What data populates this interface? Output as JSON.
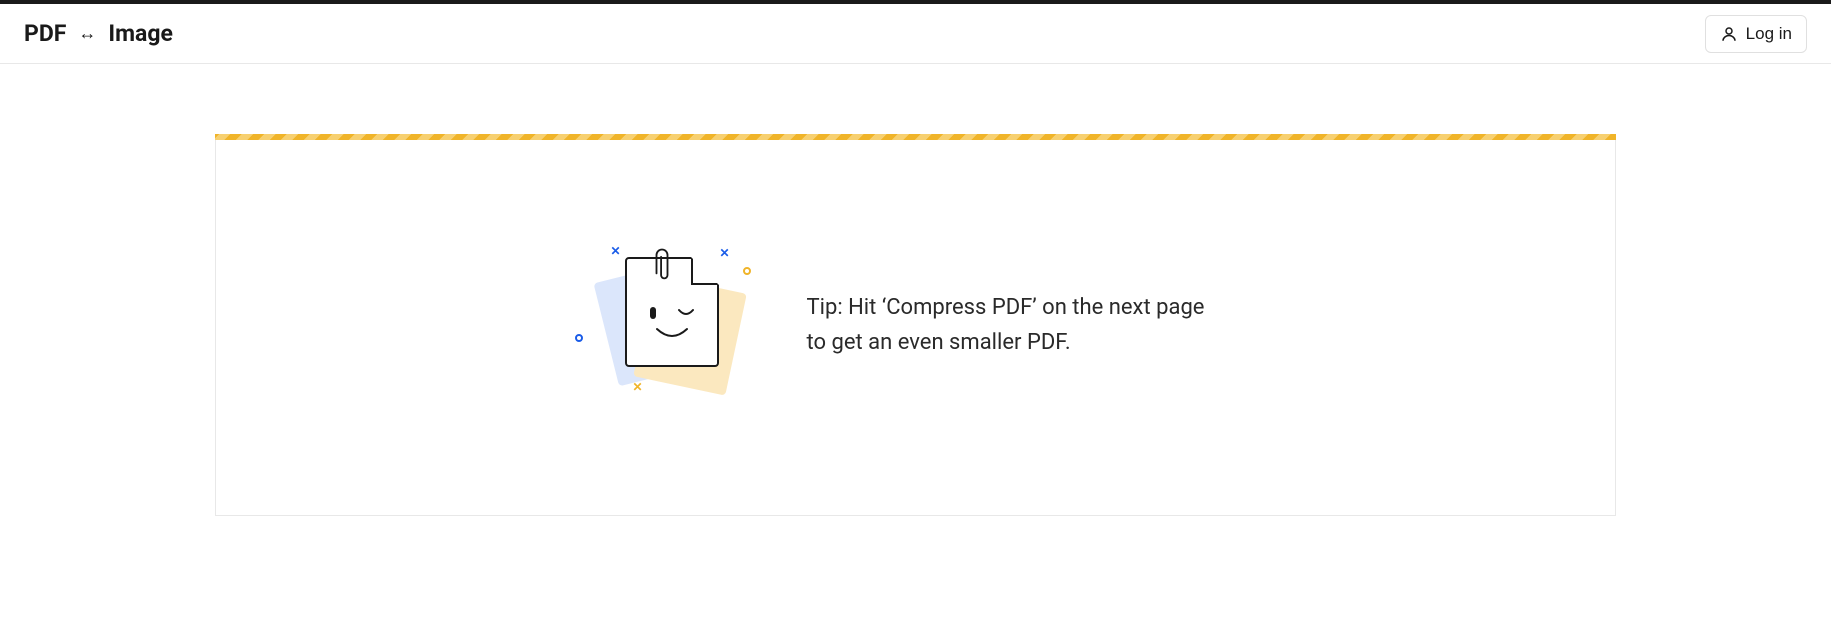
{
  "header": {
    "title_left": "PDF",
    "title_arrow": "↔",
    "title_right": "Image",
    "login_label": "Log in"
  },
  "main": {
    "tip_text": "Tip: Hit ‘Compress PDF’ on the next page to get an even smaller PDF."
  }
}
